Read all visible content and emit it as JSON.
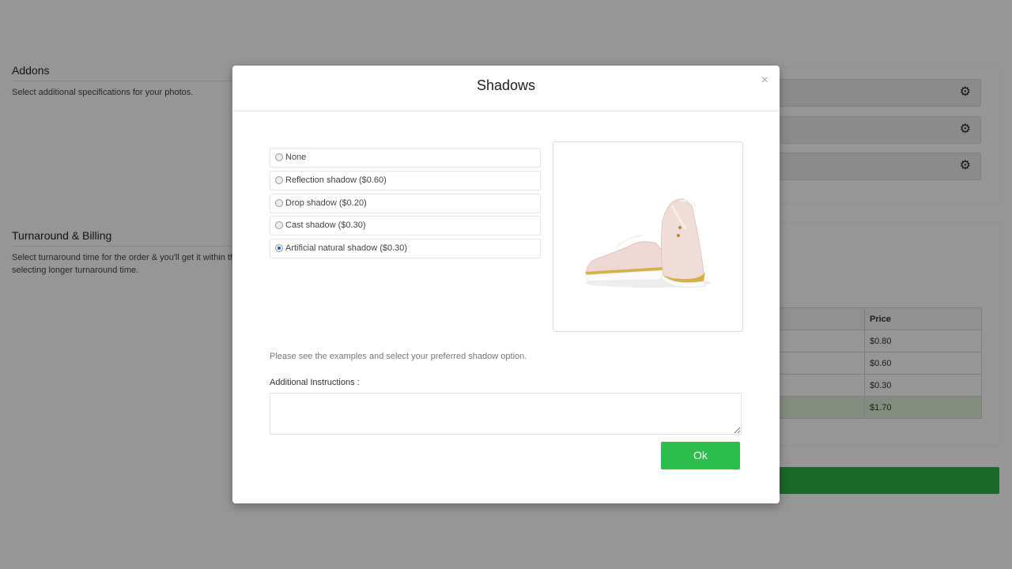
{
  "background": {
    "addons": {
      "title": "Addons",
      "description": "Select additional specifications for your photos.",
      "rows": [
        {
          "icon": "gear-icon"
        },
        {
          "icon": "gear-icon"
        },
        {
          "icon": "gear-icon"
        }
      ]
    },
    "turnaround": {
      "title": "Turnaround & Billing",
      "description": "Select turnaround time for the order & you'll get it within thi selecting longer turnaround time.",
      "description_line1": "Select turnaround time for the order & you'll get it within thi",
      "description_line2": "selecting longer turnaround time."
    },
    "billing_table": {
      "header_price": "Price",
      "rows": [
        {
          "price": "$0.80"
        },
        {
          "price": "$0.60"
        },
        {
          "price": "$0.30"
        }
      ],
      "total": {
        "price": "$1.70"
      }
    }
  },
  "modal": {
    "title": "Shadows",
    "close_label": "×",
    "options": [
      {
        "label": "None",
        "checked": false
      },
      {
        "label": "Reflection shadow ($0.60)",
        "checked": false
      },
      {
        "label": "Drop shadow ($0.20)",
        "checked": false
      },
      {
        "label": "Cast shadow ($0.30)",
        "checked": false
      },
      {
        "label": "Artificial natural shadow ($0.30)",
        "checked": true
      }
    ],
    "preview_alt": "Pink brogue shoes example",
    "hint": "Please see the examples and select your preferred shadow option.",
    "additional_label": "Additional Instructions :",
    "additional_value": "",
    "ok_label": "Ok"
  },
  "colors": {
    "ok_button": "#2dbe4e",
    "green_bar": "#2eb24a",
    "total_row": "#dff0d8"
  }
}
